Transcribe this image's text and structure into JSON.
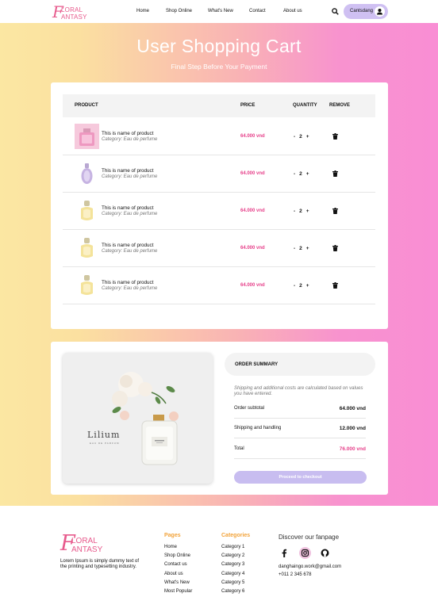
{
  "brand": {
    "top": "LORAL",
    "bottom": "ANTASY",
    "initial": "F"
  },
  "nav": {
    "links": [
      "Home",
      "Shop Online",
      "What's New",
      "Contact",
      "About us"
    ],
    "user_name": "Cantsdang"
  },
  "hero": {
    "title": "User Shopping Cart",
    "subtitle": "Final Step Before Your Payment"
  },
  "cart": {
    "headers": {
      "product": "PRODUCT",
      "price": "PRICE",
      "quantity": "QUANTITY",
      "remove": "REMOVE"
    },
    "items": [
      {
        "name": "This is name of product",
        "category": "Category: Eau de perfume",
        "price": "64.000 vnd",
        "qty": "2",
        "minus": "-",
        "plus": "+"
      },
      {
        "name": "This is name of product",
        "category": "Category: Eau de perfume",
        "price": "64.000 vnd",
        "qty": "2",
        "minus": "-",
        "plus": "+"
      },
      {
        "name": "This is name of product",
        "category": "Category: Eau de perfume",
        "price": "64.000 vnd",
        "qty": "2",
        "minus": "-",
        "plus": "+"
      },
      {
        "name": "This is name of product",
        "category": "Category: Eau de perfume",
        "price": "64.000 vnd",
        "qty": "2",
        "minus": "-",
        "plus": "+"
      },
      {
        "name": "This is name of product",
        "category": "Category: Eau de perfume",
        "price": "64.000 vnd",
        "qty": "2",
        "minus": "-",
        "plus": "+"
      }
    ]
  },
  "photo": {
    "brand": "Lilium",
    "tag": "EAU DE PARFUM"
  },
  "summary": {
    "title": "ORDER SUMMARY",
    "note": "Shipping and additional costs are calculated based on values you have entered.",
    "rows": [
      {
        "label": "Order subtotal",
        "value": "64.000 vnd"
      },
      {
        "label": "Shipping and handling",
        "value": "12.000 vnd"
      },
      {
        "label": "Total",
        "value": "76.000 vnd"
      }
    ],
    "checkout": "Proceed to checkout"
  },
  "footer": {
    "desc": "Lorem Ipsum is simply dummy text of the printing and typesetting industry.",
    "pages_title": "Pages",
    "pages": [
      "Home",
      "Shop Online",
      "Contact us",
      "About us",
      "What's New",
      "Most Popular"
    ],
    "categories_title": "Categories",
    "categories": [
      "Category 1",
      "Category 2",
      "Category 3",
      "Category 4",
      "Category 5",
      "Category 6"
    ],
    "fanpage_title": "Discover our fanpage",
    "email": "danghaingo.work@gmail.com",
    "phone": "+011 2 345 678"
  },
  "colors": {
    "accent": "#e6408a",
    "brand": "#e75a8c",
    "button": "#c8bdf0",
    "footer_heading": "#f2a33a"
  }
}
